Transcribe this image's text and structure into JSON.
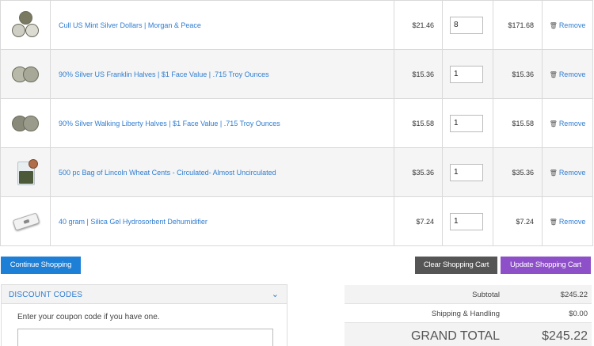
{
  "cart": {
    "items": [
      {
        "name": "Cull US Mint Silver Dollars | Morgan & Peace",
        "price": "$21.46",
        "qty": "8",
        "subtotal": "$171.68",
        "remove": "Remove",
        "image": "silver-dollars-coins"
      },
      {
        "name": "90% Silver US Franklin Halves | $1 Face Value | .715 Troy Ounces",
        "price": "$15.36",
        "qty": "1",
        "subtotal": "$15.36",
        "remove": "Remove",
        "image": "franklin-halves-coins"
      },
      {
        "name": "90% Silver Walking Liberty Halves | $1 Face Value | .715 Troy Ounces",
        "price": "$15.58",
        "qty": "1",
        "subtotal": "$15.58",
        "remove": "Remove",
        "image": "walking-liberty-halves-coins"
      },
      {
        "name": "500 pc Bag of Lincoln Wheat Cents - Circulated- Almost Uncirculated",
        "price": "$35.36",
        "qty": "1",
        "subtotal": "$35.36",
        "remove": "Remove",
        "image": "wheat-cents-bag"
      },
      {
        "name": "40 gram | Silica Gel Hydrosorbent Dehumidifier",
        "price": "$7.24",
        "qty": "1",
        "subtotal": "$7.24",
        "remove": "Remove",
        "image": "silica-gel-dehumidifier"
      }
    ]
  },
  "actions": {
    "continue": "Continue Shopping",
    "clear": "Clear Shopping Cart",
    "update": "Update Shopping Cart"
  },
  "discount": {
    "title": "DISCOUNT CODES",
    "text": "Enter your coupon code if you have one.",
    "placeholder": ""
  },
  "totals": {
    "subtotal_label": "Subtotal",
    "subtotal_value": "$245.22",
    "shipping_label": "Shipping & Handling",
    "shipping_value": "$0.00",
    "grand_label": "GRAND TOTAL",
    "grand_value": "$245.22"
  },
  "colors": {
    "link": "#2f7dd1",
    "continue_button": "#1e7fd6",
    "clear_button": "#555555",
    "update_button": "#8e50c8"
  }
}
